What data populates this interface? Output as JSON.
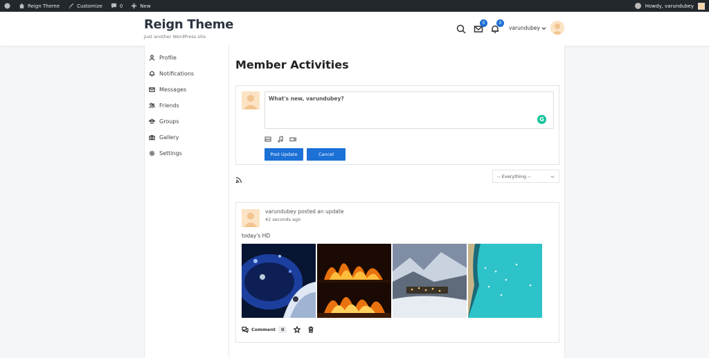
{
  "adminbar": {
    "site_name": "Reign Theme",
    "customize": "Customize",
    "comments_count": "0",
    "new": "New",
    "howdy": "Howdy, varundubey"
  },
  "header": {
    "site_title": "Reign Theme",
    "tagline": "Just another WordPress site",
    "messages_badge": "0",
    "notifications_badge": "0",
    "user_name": "varundubey"
  },
  "sidebar": {
    "items": [
      {
        "label": "Profile",
        "icon": "user-icon"
      },
      {
        "label": "Notifications",
        "icon": "bell-icon"
      },
      {
        "label": "Messages",
        "icon": "envelope-icon"
      },
      {
        "label": "Friends",
        "icon": "friends-icon"
      },
      {
        "label": "Groups",
        "icon": "groups-icon"
      },
      {
        "label": "Gallery",
        "icon": "camera-icon"
      },
      {
        "label": "Settings",
        "icon": "gear-icon"
      }
    ]
  },
  "main": {
    "page_title": "Member Activities",
    "post_box": {
      "placeholder": "What's new, varundubey?",
      "post_label": "Post Update",
      "cancel_label": "Cancel"
    },
    "filter": {
      "selected": "-- Everything --"
    },
    "activity": {
      "header": "varundubey posted an update",
      "time": "42 seconds ago",
      "text": "today's HD",
      "comment_label": "Comment",
      "comment_count": "0"
    }
  },
  "colors": {
    "accent": "#1c70d6",
    "adminbar": "#23282d",
    "grammarly": "#15c39a"
  }
}
